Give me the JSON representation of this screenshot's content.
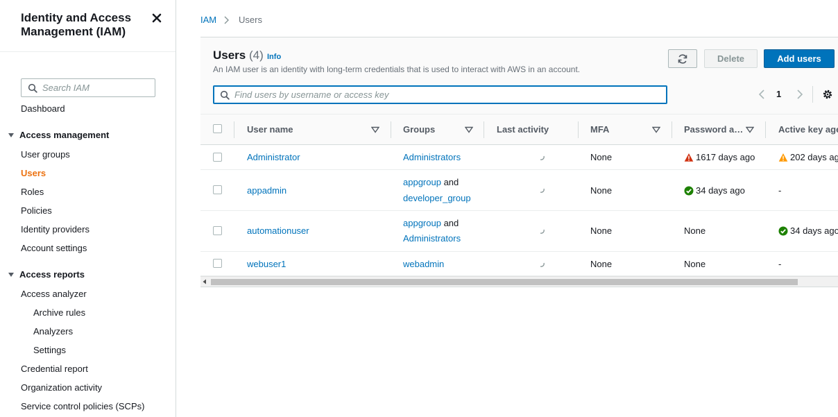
{
  "sidebar": {
    "title": "Identity and Access Management (IAM)",
    "search_placeholder": "Search IAM",
    "dashboard": "Dashboard",
    "sections": [
      {
        "label": "Access management",
        "items": [
          "User groups",
          "Users",
          "Roles",
          "Policies",
          "Identity providers",
          "Account settings"
        ],
        "active": "Users"
      },
      {
        "label": "Access reports",
        "items": [
          "Access analyzer",
          "Archive rules",
          "Analyzers",
          "Settings",
          "Credential report",
          "Organization activity",
          "Service control policies (SCPs)"
        ]
      }
    ]
  },
  "breadcrumb": {
    "root": "IAM",
    "current": "Users"
  },
  "users_panel": {
    "title": "Users",
    "count": "(4)",
    "info": "Info",
    "description": "An IAM user is an identity with long-term credentials that is used to interact with AWS in an account.",
    "buttons": {
      "refresh_icon": "refresh-icon",
      "delete": "Delete",
      "add": "Add users"
    },
    "filter_placeholder": "Find users by username or access key",
    "page": "1"
  },
  "table": {
    "columns": [
      "User name",
      "Groups",
      "Last activity",
      "MFA",
      "Password a…",
      "Active key age"
    ],
    "rows": [
      {
        "username": "Administrator",
        "groups": [
          "Administrators"
        ],
        "mfa": "None",
        "password_age": "1617 days ago",
        "password_status": "error",
        "key_age": "202 days ag",
        "key_status": "warning"
      },
      {
        "username": "appadmin",
        "groups": [
          "appgroup",
          "developer_group"
        ],
        "groups_joiner": "and",
        "mfa": "None",
        "password_age": "34 days ago",
        "password_status": "success",
        "key_age": "-",
        "key_status": "none"
      },
      {
        "username": "automationuser",
        "groups": [
          "appgroup",
          "Administrators"
        ],
        "groups_joiner": "and",
        "mfa": "None",
        "password_age": "None",
        "password_status": "none",
        "key_age": "34 days ago",
        "key_status": "success"
      },
      {
        "username": "webuser1",
        "groups": [
          "webadmin"
        ],
        "mfa": "None",
        "password_age": "None",
        "password_status": "none",
        "key_age": "-",
        "key_status": "none"
      }
    ]
  },
  "colors": {
    "link": "#0073bb",
    "active_nav": "#ec7211",
    "primary_button": "#0073bb",
    "error": "#d13212",
    "warning": "#ff9900",
    "success": "#1d8102"
  }
}
